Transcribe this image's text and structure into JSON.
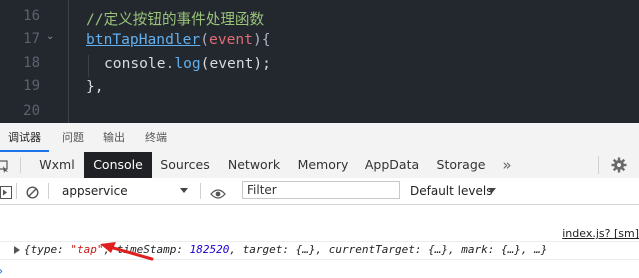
{
  "editor": {
    "lines": [
      {
        "num": "16",
        "comment": "//定义按钮的事件处理函数"
      },
      {
        "num": "17",
        "fold": "⌄",
        "fn": "btnTapHandler",
        "open": "(",
        "param": "event",
        "close": "){"
      },
      {
        "num": "18",
        "obj": "console",
        "dot": ".",
        "method": "log",
        "args": "(event);"
      },
      {
        "num": "19",
        "text": "},"
      },
      {
        "num": "20"
      }
    ]
  },
  "devtools": {
    "top_tabs": [
      "调试器",
      "问题",
      "输出",
      "终端"
    ],
    "panel_tabs": [
      "Wxml",
      "Console",
      "Sources",
      "Network",
      "Memory",
      "AppData",
      "Storage"
    ],
    "more_tabs": "»",
    "active_panel": "Console",
    "toolbar": {
      "context": "appservice",
      "filter_placeholder": "Filter",
      "levels": "Default levels"
    },
    "console": {
      "source_link": "index.js? [sm]",
      "log": {
        "open": "{",
        "k1": "type",
        "v1": "\"tap\"",
        "k2": "timeStamp",
        "v2": "182520",
        "k3": "target",
        "v3": "{…}",
        "k4": "currentTarget",
        "v4": "{…}",
        "k5": "mark",
        "v5": "{…}",
        "tail": "…}"
      }
    }
  },
  "colors": {
    "editor_bg": "#23272e",
    "comment": "#98c379",
    "function": "#61afef",
    "param": "#e06c75",
    "active_tab_bg": "#202124",
    "arrow": "#e02020",
    "string": "#c41a16",
    "number": "#1c00cf"
  }
}
